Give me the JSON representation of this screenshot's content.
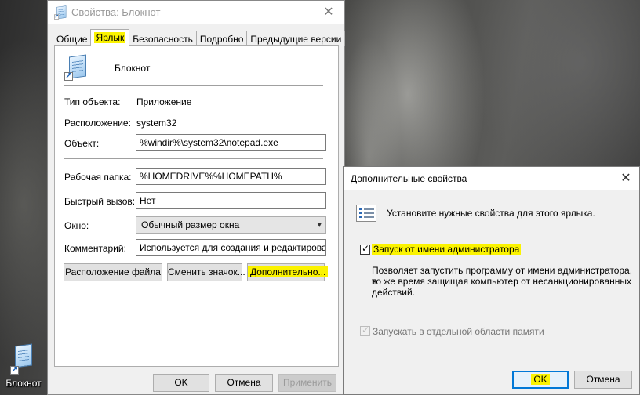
{
  "desktop": {
    "icon_label": "Блокнот"
  },
  "properties_window": {
    "title": "Свойства: Блокнот",
    "tabs": [
      "Общие",
      "Ярлык",
      "Безопасность",
      "Подробно",
      "Предыдущие версии"
    ],
    "active_tab": "Ярлык",
    "shortcut_name": "Блокнот",
    "rows": {
      "type_label": "Тип объекта:",
      "type_value": "Приложение",
      "location_label": "Расположение:",
      "location_value": "system32",
      "target_label": "Объект:",
      "target_value": "%windir%\\system32\\notepad.exe",
      "workdir_label": "Рабочая папка:",
      "workdir_value": "%HOMEDRIVE%%HOMEPATH%",
      "hotkey_label": "Быстрый вызов:",
      "hotkey_value": "Нет",
      "window_label": "Окно:",
      "window_value": "Обычный размер окна",
      "comment_label": "Комментарий:",
      "comment_value": "Используется для создания и редактирования"
    },
    "buttons": {
      "open_location": "Расположение файла",
      "change_icon": "Сменить значок...",
      "advanced": "Дополнительно...",
      "ok": "OK",
      "cancel": "Отмена",
      "apply": "Применить"
    }
  },
  "advanced_window": {
    "title": "Дополнительные свойства",
    "instruction": "Установите нужные свойства для этого ярлыка.",
    "run_as_admin_label": "Запуск от имени администратора",
    "run_as_admin_checked": true,
    "description_line1": "Позволяет запустить программу от имени администратора, в",
    "description_line2": "то же время защищая компьютер от несанкционированных",
    "description_line3": "действий.",
    "separate_memory_label": "Запускать в отдельной области памяти",
    "separate_memory_checked": true,
    "buttons": {
      "ok": "OK",
      "cancel": "Отмена"
    }
  },
  "colors": {
    "highlight": "#fbf300",
    "focus_border": "#0078d7"
  }
}
